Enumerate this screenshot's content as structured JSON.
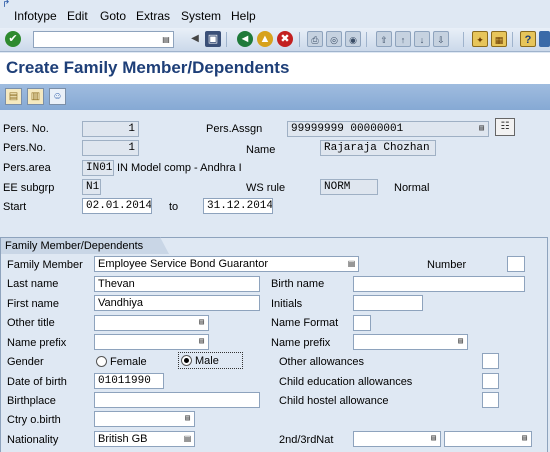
{
  "menubar": {
    "items": [
      "Infotype",
      "Edit",
      "Goto",
      "Extras",
      "System",
      "Help"
    ]
  },
  "toolbar": {
    "icons": [
      "check-icon",
      "back-icon",
      "exit-icon",
      "cancel-icon",
      "print-icon",
      "find-icon",
      "find-next-icon",
      "first-page-icon",
      "prev-page-icon",
      "next-page-icon",
      "last-page-icon",
      "create-session-icon",
      "shortcut-icon",
      "help-icon",
      "customize-icon"
    ],
    "colors": {
      "check": "#2f8a2f",
      "nav": "#1f7a3a",
      "exit": "#d7a21c",
      "cancel": "#c32020"
    }
  },
  "title": "Create Family Member/Dependents",
  "header": {
    "pers_no_label": "Pers. No.",
    "pers_no_value": "1",
    "pers_no2_label": "Pers.No.",
    "pers_no2_value": "1",
    "pers_assgn_label": "Pers.Assgn",
    "pers_assgn_value": "99999999 00000001",
    "name_label": "Name",
    "name_value": "Rajaraja Chozhan",
    "pers_area_label": "Pers.area",
    "pers_area_code": "IN01",
    "pers_area_text": "IN Model comp - Andhra I",
    "ee_subgrp_label": "EE subgrp",
    "ee_subgrp_value": "N1",
    "ws_rule_label": "WS rule",
    "ws_rule_value": "NORM",
    "ws_rule_text": "Normal",
    "start_label": "Start",
    "start_value": "02.01.2014",
    "to_label": "to",
    "end_value": "31.12.2014"
  },
  "group": {
    "title": "Family Member/Dependents",
    "family_member_label": "Family Member",
    "family_member_value": "Employee Service Bond Guarantor",
    "number_label": "Number",
    "number_value": "",
    "last_name_label": "Last name",
    "last_name_value": "Thevan",
    "birth_name_label": "Birth name",
    "birth_name_value": "",
    "first_name_label": "First name",
    "first_name_value": "Vandhiya",
    "initials_label": "Initials",
    "initials_value": "",
    "other_title_label": "Other title",
    "other_title_value": "",
    "name_format_label": "Name Format",
    "name_format_value": "",
    "name_prefix_label": "Name prefix",
    "name_prefix_value": "",
    "name_prefix2_label": "Name prefix",
    "name_prefix2_value": "",
    "gender_label": "Gender",
    "gender_female": "Female",
    "gender_male": "Male",
    "gender_selected": "Male",
    "other_allowances_label": "Other allowances",
    "dob_label": "Date of birth",
    "dob_value": "01011990",
    "child_edu_label": "Child education allowances",
    "birthplace_label": "Birthplace",
    "birthplace_value": "",
    "child_hostel_label": "Child hostel allowance",
    "ctry_birth_label": "Ctry o.birth",
    "ctry_birth_value": "",
    "nationality_label": "Nationality",
    "nationality_value": "British GB",
    "nat2_label": "2nd/3rdNat",
    "nat2_value": "",
    "nat3_value": ""
  }
}
